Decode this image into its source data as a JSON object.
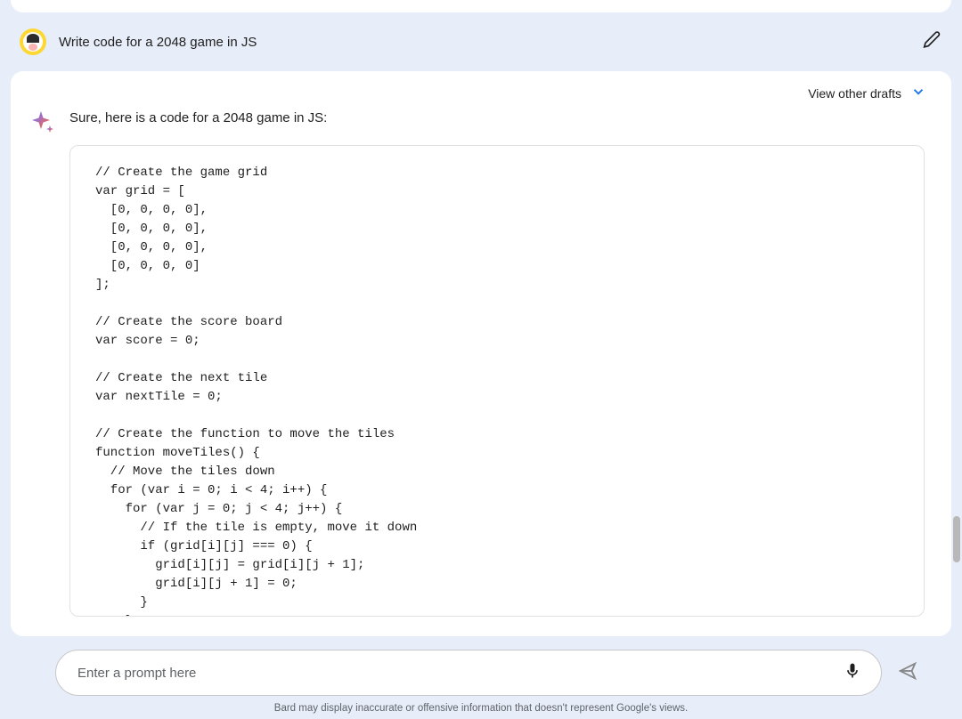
{
  "user_message": {
    "text": "Write code for a 2048 game in JS"
  },
  "response": {
    "view_drafts_label": "View other drafts",
    "intro_text": "Sure, here is a code for a 2048 game in JS:",
    "code": "// Create the game grid\nvar grid = [\n  [0, 0, 0, 0],\n  [0, 0, 0, 0],\n  [0, 0, 0, 0],\n  [0, 0, 0, 0]\n];\n\n// Create the score board\nvar score = 0;\n\n// Create the next tile\nvar nextTile = 0;\n\n// Create the function to move the tiles\nfunction moveTiles() {\n  // Move the tiles down\n  for (var i = 0; i < 4; i++) {\n    for (var j = 0; j < 4; j++) {\n      // If the tile is empty, move it down\n      if (grid[i][j] === 0) {\n        grid[i][j] = grid[i][j + 1];\n        grid[i][j + 1] = 0;\n      }\n    }\n  }"
  },
  "input": {
    "placeholder": "Enter a prompt here"
  },
  "disclaimer": "Bard may display inaccurate or offensive information that doesn't represent Google's views."
}
